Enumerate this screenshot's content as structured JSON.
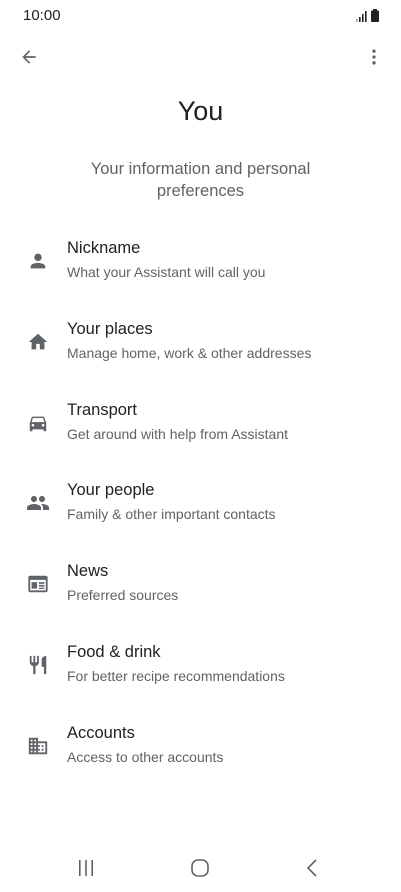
{
  "status_bar": {
    "time": "10:00",
    "icons": [
      "signal-icon",
      "battery-icon"
    ]
  },
  "app_bar": {
    "back_icon": "arrow-back-icon",
    "more_icon": "more-vert-icon"
  },
  "header": {
    "title": "You",
    "subtitle": "Your information and personal preferences"
  },
  "items": [
    {
      "title": "Nickname",
      "subtitle": "What your Assistant will call you",
      "icon": "person-icon"
    },
    {
      "title": "Your places",
      "subtitle": "Manage home, work & other addresses",
      "icon": "home-icon"
    },
    {
      "title": "Transport",
      "subtitle": "Get around with help from Assistant",
      "icon": "car-icon"
    },
    {
      "title": "Your people",
      "subtitle": "Family & other important contacts",
      "icon": "people-icon"
    },
    {
      "title": "News",
      "subtitle": "Preferred sources",
      "icon": "news-icon"
    },
    {
      "title": "Food & drink",
      "subtitle": "For better recipe recommendations",
      "icon": "restaurant-icon"
    },
    {
      "title": "Accounts",
      "subtitle": "Access to other accounts",
      "icon": "building-icon"
    }
  ],
  "nav_bar": {
    "icons": [
      "recents-icon",
      "home-circle-icon",
      "nav-back-icon"
    ]
  },
  "colors": {
    "text_primary": "#202124",
    "text_secondary": "#5f6368",
    "icon": "#5f6368",
    "background": "#ffffff"
  }
}
